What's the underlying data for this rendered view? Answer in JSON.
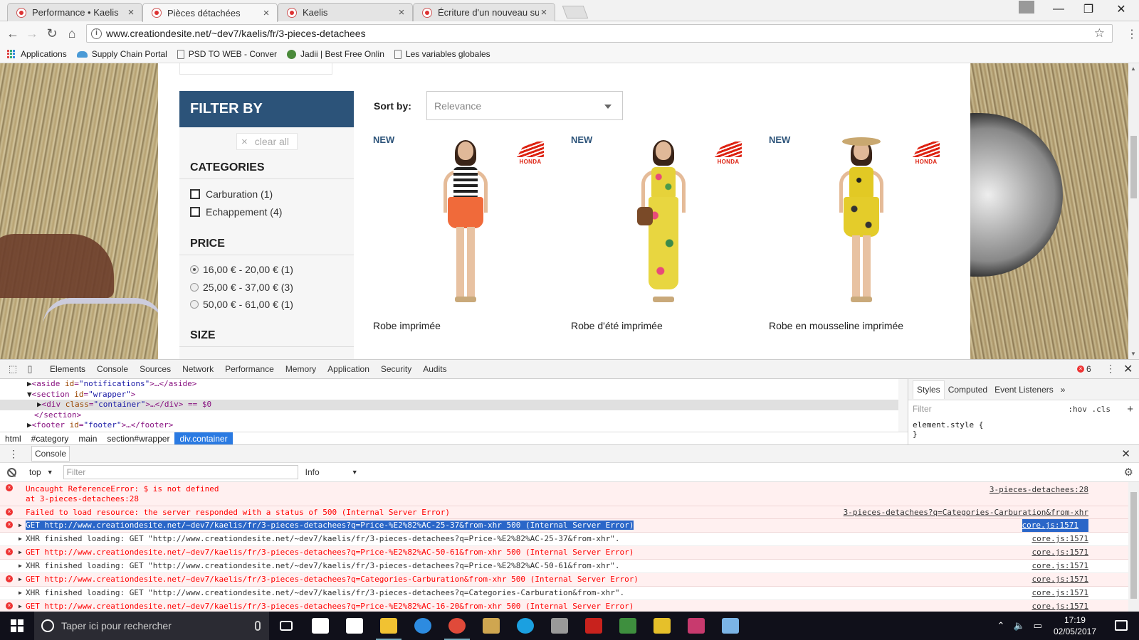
{
  "browser": {
    "tabs": [
      {
        "title": "Performance • Kaelis",
        "active": false
      },
      {
        "title": "Pièces détachées",
        "active": true
      },
      {
        "title": "Kaelis",
        "active": false
      },
      {
        "title": "Écriture d'un nouveau su",
        "active": false
      }
    ],
    "url": "www.creationdesite.net/~dev7/kaelis/fr/3-pieces-detachees",
    "bookmarks": [
      {
        "label": "Applications",
        "icon": "apps-grid-icon"
      },
      {
        "label": "Supply Chain Portal",
        "icon": "cloud-icon"
      },
      {
        "label": "PSD TO WEB - Conver",
        "icon": "page-icon"
      },
      {
        "label": "Jadii | Best Free Onlin",
        "icon": "jadii-icon"
      },
      {
        "label": "Les variables globales",
        "icon": "page-icon"
      }
    ]
  },
  "page": {
    "filter": {
      "title": "FILTER BY",
      "clear_all": "clear all",
      "categories_title": "CATEGORIES",
      "categories": [
        {
          "label": "Carburation (1)",
          "checked": false
        },
        {
          "label": "Echappement (4)",
          "checked": false
        }
      ],
      "price_title": "PRICE",
      "prices": [
        {
          "label": "16,00 € - 20,00 € (1)",
          "selected": true
        },
        {
          "label": "25,00 € - 37,00 € (3)",
          "selected": false
        },
        {
          "label": "50,00 € - 61,00 € (1)",
          "selected": false
        }
      ],
      "size_title": "SIZE"
    },
    "sort": {
      "label": "Sort by:",
      "value": "Relevance"
    },
    "products": [
      {
        "badge": "NEW",
        "brand": "HONDA",
        "name": "Robe imprimée",
        "top_color": "#222222",
        "skirt_color": "#f06a3a"
      },
      {
        "badge": "NEW",
        "brand": "HONDA",
        "name": "Robe d'été imprimée",
        "top_color": "#e6d23a",
        "skirt_color": "#e8d640"
      },
      {
        "badge": "NEW",
        "brand": "HONDA",
        "name": "Robe en mousseline imprimée",
        "top_color": "#e2c924",
        "skirt_color": "#e4cc2a"
      }
    ]
  },
  "devtools": {
    "tabs": [
      "Elements",
      "Console",
      "Sources",
      "Network",
      "Performance",
      "Memory",
      "Application",
      "Security",
      "Audits"
    ],
    "error_count": "6",
    "elements": [
      {
        "arrow": "▶",
        "tag_open": "<aside ",
        "attr": "id",
        "value": "\"notifications\"",
        "rest": ">…</aside>"
      },
      {
        "arrow": "▼",
        "tag_open": "<section ",
        "attr": "id",
        "value": "\"wrapper\"",
        "rest": ">"
      },
      {
        "arrow": "▶",
        "tag_open": "<div ",
        "attr": "class",
        "value": "\"container\"",
        "rest": ">…</div> == $0"
      },
      {
        "arrow": "",
        "tag_open": "</section>",
        "attr": "",
        "value": "",
        "rest": ""
      },
      {
        "arrow": "▶",
        "tag_open": "<footer ",
        "attr": "id",
        "value": "\"footer\"",
        "rest": ">…</footer>"
      }
    ],
    "breadcrumbs": [
      "html",
      "#category",
      "main",
      "section#wrapper",
      "div.container"
    ],
    "styles": {
      "tabs": [
        "Styles",
        "Computed",
        "Event Listeners",
        "»"
      ],
      "filter_placeholder": "Filter",
      "hov": ":hov",
      "cls": ".cls",
      "rule_open": "element.style {",
      "rule_close": "}"
    },
    "console": {
      "drawer_tab": "Console",
      "context": "top",
      "filter_placeholder": "Filter",
      "level": "Info",
      "messages": [
        {
          "type": "err",
          "text": "Uncaught ReferenceError: $ is not defined",
          "text2": "    at 3-pieces-detachees:28",
          "source": "3-pieces-detachees:28"
        },
        {
          "type": "err",
          "text": "Failed to load resource: the server responded with a status of 500 (Internal Server Error)",
          "source": "3-pieces-detachees?q=Categories-Carburation&from-xhr"
        },
        {
          "type": "err",
          "hl": true,
          "arrow": "▶",
          "text": "GET http://www.creationdesite.net/~dev7/kaelis/fr/3-pieces-detachees?q=Price-%E2%82%AC-25-37&from-xhr 500 (Internal Server Error)",
          "source": "core.js:1571"
        },
        {
          "type": "info",
          "arrow": "▶",
          "text": "XHR finished loading: GET \"http://www.creationdesite.net/~dev7/kaelis/fr/3-pieces-detachees?q=Price-%E2%82%AC-25-37&from-xhr\".",
          "source": "core.js:1571"
        },
        {
          "type": "err",
          "arrow": "▶",
          "text": "GET http://www.creationdesite.net/~dev7/kaelis/fr/3-pieces-detachees?q=Price-%E2%82%AC-50-61&from-xhr 500 (Internal Server Error)",
          "source": "core.js:1571"
        },
        {
          "type": "info",
          "arrow": "▶",
          "text": "XHR finished loading: GET \"http://www.creationdesite.net/~dev7/kaelis/fr/3-pieces-detachees?q=Price-%E2%82%AC-50-61&from-xhr\".",
          "source": "core.js:1571"
        },
        {
          "type": "err",
          "arrow": "▶",
          "text": "GET http://www.creationdesite.net/~dev7/kaelis/fr/3-pieces-detachees?q=Categories-Carburation&from-xhr 500 (Internal Server Error)",
          "source": "core.js:1571"
        },
        {
          "type": "info",
          "arrow": "▶",
          "text": "XHR finished loading: GET \"http://www.creationdesite.net/~dev7/kaelis/fr/3-pieces-detachees?q=Categories-Carburation&from-xhr\".",
          "source": "core.js:1571"
        },
        {
          "type": "err",
          "arrow": "▶",
          "text": "GET http://www.creationdesite.net/~dev7/kaelis/fr/3-pieces-detachees?q=Price-%E2%82%AC-16-20&from-xhr 500 (Internal Server Error)",
          "source": "core.js:1571"
        }
      ]
    }
  },
  "taskbar": {
    "search_placeholder": "Taper ici pour rechercher",
    "apps": [
      {
        "name": "task-view-icon",
        "color": "#ffffff"
      },
      {
        "name": "calendar-app-icon",
        "color": "#ffffff"
      },
      {
        "name": "calculator-icon",
        "color": "#ffffff"
      },
      {
        "name": "file-explorer-icon",
        "color": "#f1c232"
      },
      {
        "name": "edge-icon",
        "color": "#2d8be0"
      },
      {
        "name": "chrome-icon",
        "color": "#e04a3a"
      },
      {
        "name": "finder-folder-icon",
        "color": "#cfa650"
      },
      {
        "name": "skype-icon",
        "color": "#1ba0e0"
      },
      {
        "name": "cat-app-icon",
        "color": "#999999"
      },
      {
        "name": "filezilla-icon",
        "color": "#c8221d"
      },
      {
        "name": "spreadsheet-icon",
        "color": "#3e8f3e"
      },
      {
        "name": "lumin-icon",
        "color": "#e6c02a"
      },
      {
        "name": "photo-app-icon",
        "color": "#c83a6e"
      },
      {
        "name": "paint-icon",
        "color": "#7bb4e6"
      }
    ],
    "time": "17:19",
    "date": "02/05/2017"
  }
}
